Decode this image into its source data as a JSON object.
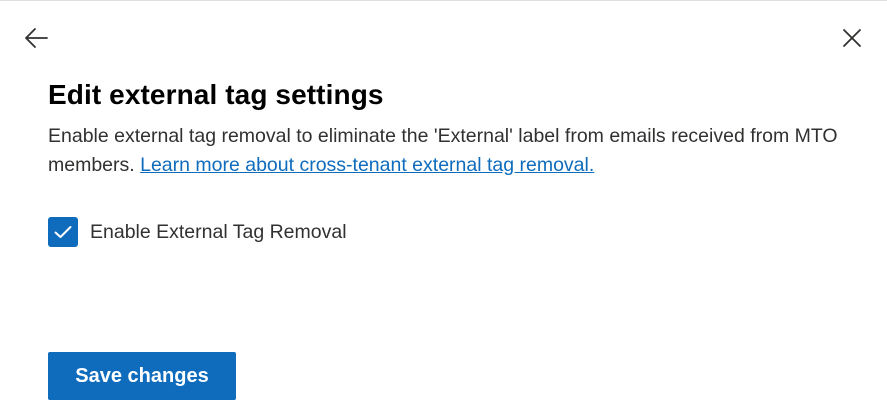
{
  "header": {
    "back_icon": "arrow-left-icon",
    "close_icon": "close-icon"
  },
  "title": "Edit external tag settings",
  "description": {
    "text": "Enable external tag removal to eliminate the 'External' label from emails received from MTO members. ",
    "link_label": "Learn more about cross-tenant external tag removal."
  },
  "option": {
    "label": "Enable External Tag Removal",
    "checked": true
  },
  "actions": {
    "save_label": "Save changes"
  },
  "colors": {
    "accent": "#0f6cbd",
    "text": "#323130",
    "title": "#000000",
    "border": "#e1dfdd"
  }
}
